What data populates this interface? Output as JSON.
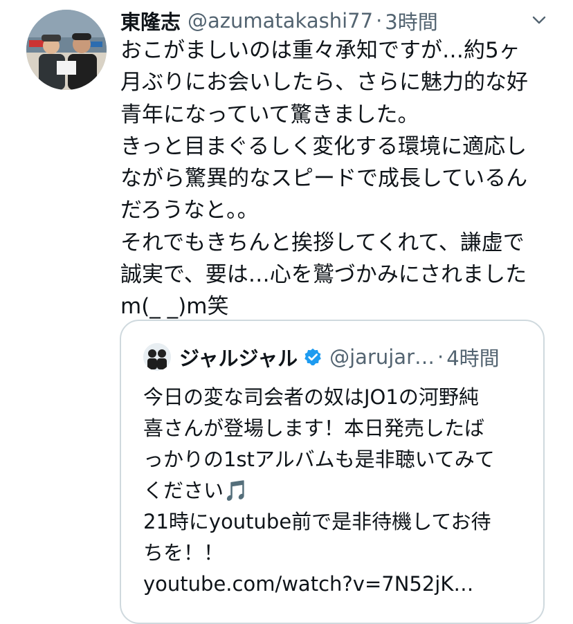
{
  "tweet": {
    "author_name": "東隆志",
    "author_handle": "@azumatakashi77",
    "separator": "·",
    "time": "3時間",
    "lines": [
      "おこがましいのは重々承知ですが…約5ヶ",
      "月ぶりにお会いしたら、さらに魅力的な好",
      "青年になっていて驚きました。",
      "きっと目まぐるしく変化する環境に適応し",
      "ながら驚異的なスピードで成長しているん",
      "だろうなと。。",
      "それでもきちんと挨拶してくれて、謙虚で",
      "誠実で、要は…心を鷲づかみにされました",
      "m(_ _)m笑"
    ]
  },
  "quote": {
    "author_name": "ジャルジャル",
    "author_handle": "@jarujar…",
    "separator": "·",
    "time": "4時間",
    "lines": [
      "今日の変な司会者の奴はJO1の河野純",
      "喜さんが登場します！本日発売したば",
      "っかりの1stアルバムも是非聴いてみて",
      "ください🎵",
      "21時にyoutube前で是非待機してお待",
      "ちを！！",
      "youtube.com/watch?v=7N52jK…"
    ]
  },
  "icons": {
    "more": "chevron-down-icon",
    "verified": "verified-badge-icon",
    "music": "music-note-icon"
  },
  "colors": {
    "text": "#0f1419",
    "secondary": "#536471",
    "border": "#cfd9de",
    "verified": "#1d9bf0"
  }
}
